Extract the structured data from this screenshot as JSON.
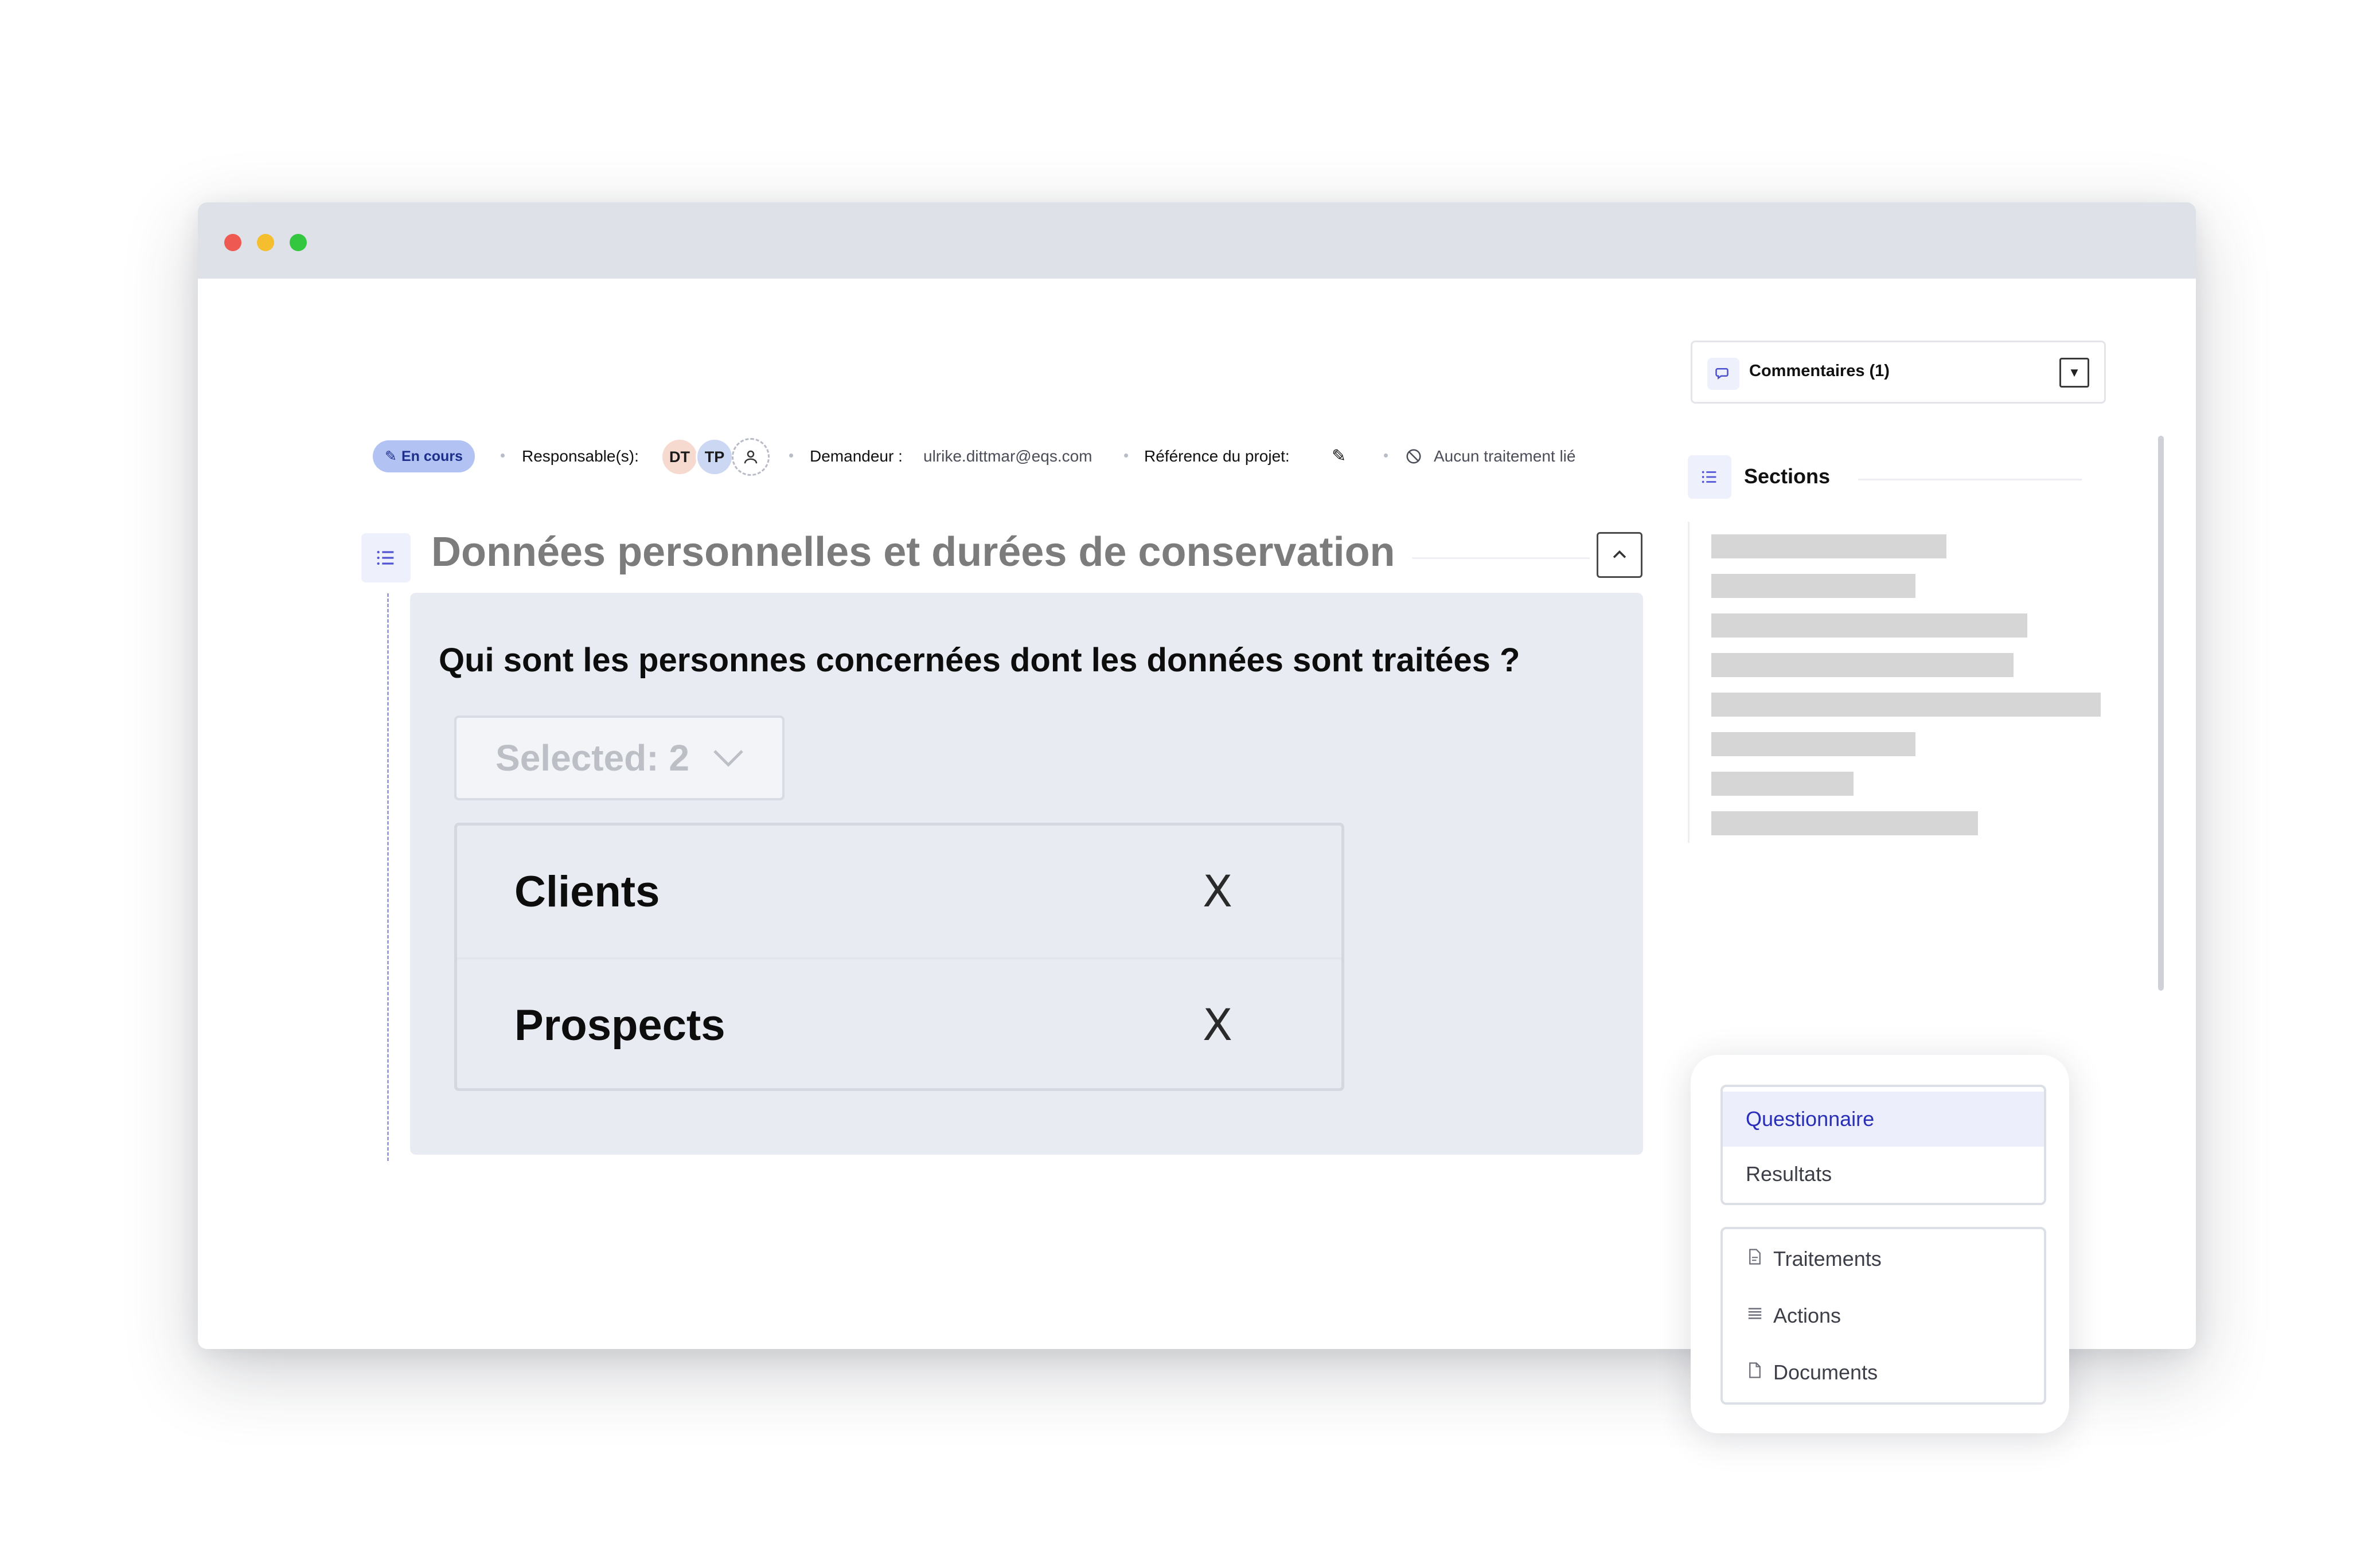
{
  "header": {
    "status": "En cours",
    "responsables_label": "Responsable(s):",
    "avatars": [
      "DT",
      "TP"
    ],
    "demandeur_label": "Demandeur :",
    "demandeur_email": "ulrike.dittmar@eqs.com",
    "reference_label": "Référence du projet:",
    "traitement": "Aucun traitement lié"
  },
  "comments": {
    "label": "Commentaires (1)"
  },
  "section": {
    "title": "Données personnelles et durées de conservation"
  },
  "question": {
    "title": "Qui sont les personnes concernées dont les données sont traitées ?",
    "select_label": "Selected: 2",
    "options": [
      "Clients",
      "Prospects"
    ],
    "remove_glyph": "X"
  },
  "sidebar": {
    "title": "Sections"
  },
  "nav": {
    "tabs": [
      {
        "label": "Questionnaire",
        "active": true
      },
      {
        "label": "Resultats",
        "active": false
      }
    ],
    "links": [
      {
        "label": "Traitements",
        "icon": "document-icon"
      },
      {
        "label": "Actions",
        "icon": "list-icon"
      },
      {
        "label": "Documents",
        "icon": "file-icon"
      }
    ]
  },
  "colors": {
    "accent": "#5254d6",
    "badge_bg": "#b2c3f3",
    "card_bg": "#e9ebf3",
    "active_tab_bg": "#eceefc"
  }
}
